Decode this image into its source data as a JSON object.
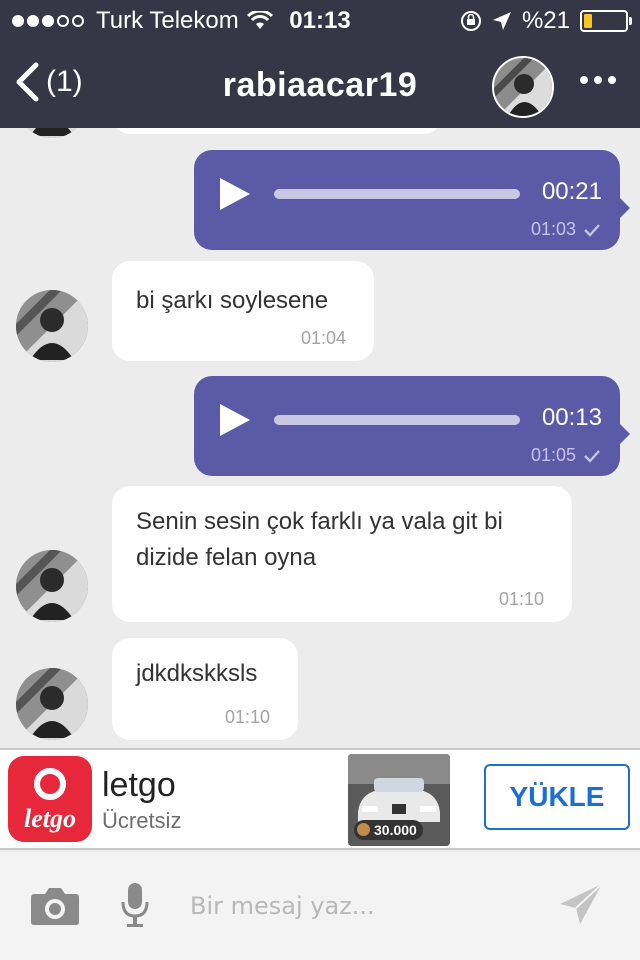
{
  "status_bar": {
    "carrier": "Turk Telekom",
    "time": "01:13",
    "battery": "%21",
    "battery_level": 0.21,
    "battery_color": "#f5c623"
  },
  "header": {
    "back_count": "(1)",
    "title": "rabiaacar19"
  },
  "messages": [
    {
      "direction": "outgoing",
      "type": "voice",
      "duration": "00:21",
      "time": "01:03",
      "status_icon": "check-icon"
    },
    {
      "direction": "incoming",
      "type": "text",
      "text": "bi şarkı soylesene",
      "time": "01:04"
    },
    {
      "direction": "outgoing",
      "type": "voice",
      "duration": "00:13",
      "time": "01:05",
      "status_icon": "check-icon"
    },
    {
      "direction": "incoming",
      "type": "text",
      "text": "Senin sesin çok farklı ya vala git bi dizide felan oyna",
      "time": "01:10"
    },
    {
      "direction": "incoming",
      "type": "text",
      "text": "jdkdkskksls",
      "time": "01:10"
    }
  ],
  "ad": {
    "icon_word": "letgo",
    "app_name": "letgo",
    "subtitle": "Ücretsiz",
    "price": "30.000",
    "button": "YÜKLE"
  },
  "input": {
    "placeholder": "Bir mesaj yaz..."
  },
  "colors": {
    "header": "#353746",
    "outgoing_bubble": "#5b5aa6",
    "incoming_bubble": "#ffffff",
    "chat_background": "#ececec",
    "ad_brand": "#e6283a",
    "install_button": "#1c6fd2"
  }
}
